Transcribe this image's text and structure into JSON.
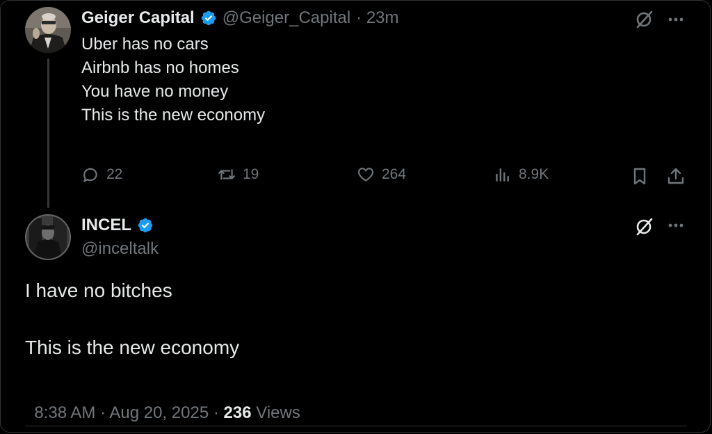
{
  "tweet1": {
    "author_name": "Geiger Capital",
    "handle": "@Geiger_Capital",
    "time": "· 23m",
    "lines": [
      "Uber has no cars",
      "Airbnb has no homes",
      "You have no money",
      "",
      "This is the new economy"
    ],
    "replies": "22",
    "retweets": "19",
    "likes": "264",
    "views": "8.9K"
  },
  "tweet2": {
    "author_name": "INCEL",
    "handle": "@inceltalk",
    "line1": "I have no bitches",
    "line2": "This is the new economy",
    "timestamp": "8:38 AM · Aug 20, 2025 · ",
    "views_count": "236",
    "views_label": " Views"
  },
  "colors": {
    "background": "#000000",
    "text": "#e7e9ea",
    "muted": "#71767b",
    "verified": "#1d9bf0",
    "divider": "#2f3336"
  },
  "icons": [
    "verified-badge-icon",
    "grok-icon",
    "more-icon",
    "reply-icon",
    "retweet-icon",
    "like-icon",
    "views-icon",
    "bookmark-icon",
    "share-icon"
  ]
}
